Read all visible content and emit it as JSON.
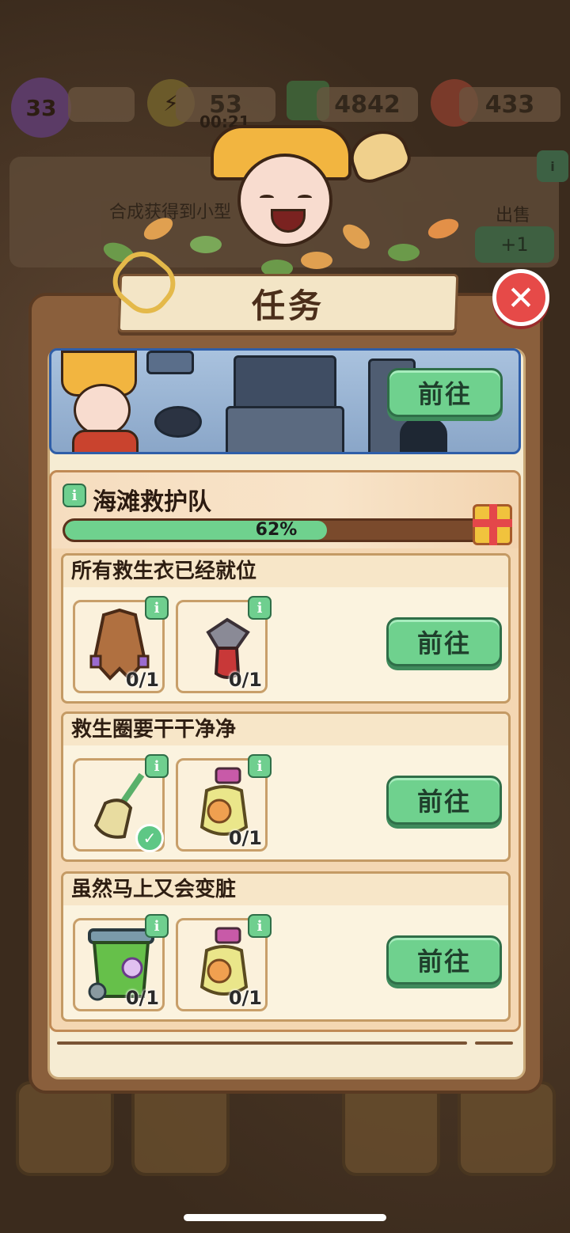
{
  "hud": {
    "level": "33",
    "energy": "53",
    "energy_timer": "00:21",
    "cash": "4842",
    "gems": "433"
  },
  "background_card": {
    "text": "合成获得到小型",
    "sell_label": "出售",
    "sell_button": "+1"
  },
  "modal": {
    "title": "任务",
    "close_icon": "close-icon",
    "scene_button": "前往",
    "quest": {
      "title": "海滩救护队",
      "progress_percent": 62,
      "progress_label": "62%",
      "subtasks": [
        {
          "title": "所有救生衣已经就位",
          "button": "前往",
          "items": [
            {
              "icon": "life-jacket-icon",
              "count": "0/1",
              "done": false
            },
            {
              "icon": "cap-icon",
              "count": "0/1",
              "done": false
            }
          ]
        },
        {
          "title": "救生圈要干干净净",
          "button": "前往",
          "items": [
            {
              "icon": "broom-icon",
              "count": "",
              "done": true
            },
            {
              "icon": "spray-bottle-icon",
              "count": "0/1",
              "done": false
            }
          ]
        },
        {
          "title": "虽然马上又会变脏",
          "button": "前往",
          "items": [
            {
              "icon": "trash-bin-icon",
              "count": "0/1",
              "done": false
            },
            {
              "icon": "spray-bottle-icon",
              "count": "0/1",
              "done": false
            }
          ]
        }
      ]
    }
  },
  "colors": {
    "accent_green": "#6fd18e",
    "close_red": "#e64a48",
    "modal_brown": "#8a5f3c"
  }
}
